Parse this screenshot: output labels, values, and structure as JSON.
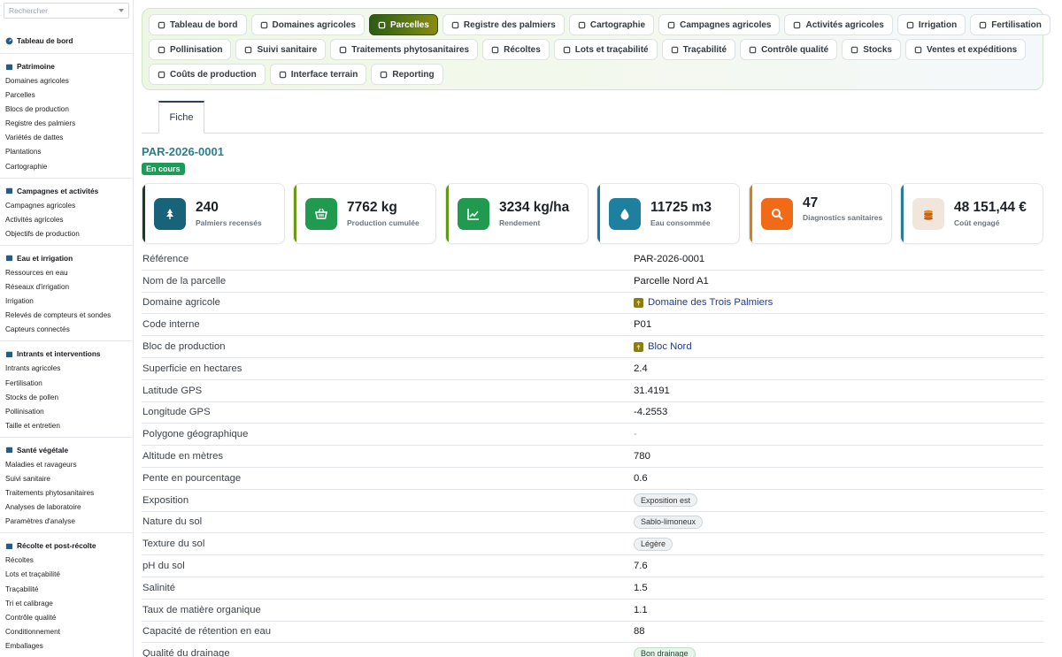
{
  "sidebar": {
    "search_placeholder": "Rechercher",
    "top_link": "Tableau de bord",
    "groups": [
      {
        "title": "Patrimoine",
        "items": [
          "Domaines agricoles",
          "Parcelles",
          "Blocs de production",
          "Registre des palmiers",
          "Variétés de dattes",
          "Plantations",
          "Cartographie"
        ]
      },
      {
        "title": "Campagnes et activités",
        "items": [
          "Campagnes agricoles",
          "Activités agricoles",
          "Objectifs de production"
        ]
      },
      {
        "title": "Eau et irrigation",
        "items": [
          "Ressources en eau",
          "Réseaux d'irrigation",
          "Irrigation",
          "Relevés de compteurs et sondes",
          "Capteurs connectés"
        ]
      },
      {
        "title": "Intrants et interventions",
        "items": [
          "Intrants agricoles",
          "Fertilisation",
          "Stocks de pollen",
          "Pollinisation",
          "Taille et entretien"
        ]
      },
      {
        "title": "Santé végétale",
        "items": [
          "Maladies et ravageurs",
          "Suivi sanitaire",
          "Traitements phytosanitaires",
          "Analyses de laboratoire",
          "Paramètres d'analyse"
        ]
      },
      {
        "title": "Récolte et post-récolte",
        "items": [
          "Récoltes",
          "Lots et traçabilité",
          "Traçabilité",
          "Tri et calibrage",
          "Contrôle qualité",
          "Conditionnement",
          "Emballages"
        ]
      }
    ]
  },
  "modules": {
    "active": "Parcelles",
    "rows": [
      [
        "Tableau de bord",
        "Domaines agricoles",
        "Parcelles",
        "Registre des palmiers",
        "Cartographie",
        "Campagnes agricoles",
        "Activités agricoles",
        "Irrigation",
        "Fertilisation"
      ],
      [
        "Pollinisation",
        "Suivi sanitaire",
        "Traitements phytosanitaires",
        "Récoltes",
        "Lots et traçabilité",
        "Traçabilité",
        "Contrôle qualité",
        "Stocks",
        "Ventes et expéditions"
      ],
      [
        "Coûts de production",
        "Interface terrain",
        "Reporting"
      ]
    ]
  },
  "tabs": {
    "fiche": "Fiche"
  },
  "record": {
    "title": "PAR-2026-0001",
    "status": "En cours"
  },
  "kpis": [
    {
      "value": "240",
      "label": "Palmiers recensés",
      "icon": "palm-tree-icon"
    },
    {
      "value": "7762 kg",
      "label": "Production cumulée",
      "icon": "basket-icon"
    },
    {
      "value": "3234 kg/ha",
      "label": "Rendement",
      "icon": "chart-up-icon"
    },
    {
      "value": "11725 m3",
      "label": "Eau consommée",
      "icon": "water-drop-icon"
    },
    {
      "value": "47",
      "label": "Diagnostics sanitaires",
      "icon": "magnifier-icon"
    },
    {
      "value": "48 151,44 €",
      "label": "Coût engagé",
      "icon": "coins-icon"
    }
  ],
  "colors": {
    "kpi_bars": [
      "#1a3d1e",
      "#6a9a12",
      "#5f9a14",
      "#1b7a92",
      "#e07a16",
      "#2a7d96"
    ],
    "kpi_icon_bg": [
      "#17647a",
      "#1f9a4f",
      "#1f9a4f",
      "#1e7f9e",
      "#f06a18",
      "#f0e6dc"
    ]
  },
  "fields": [
    {
      "label": "Référence",
      "value": "PAR-2026-0001",
      "kind": "text"
    },
    {
      "label": "Nom de la parcelle",
      "value": "Parcelle Nord A1",
      "kind": "text"
    },
    {
      "label": "Domaine agricole",
      "value": "Domaine des Trois Palmiers",
      "kind": "link"
    },
    {
      "label": "Code interne",
      "value": "P01",
      "kind": "text"
    },
    {
      "label": "Bloc de production",
      "value": "Bloc Nord",
      "kind": "link"
    },
    {
      "label": "Superficie en hectares",
      "value": "2.4",
      "kind": "text"
    },
    {
      "label": "Latitude GPS",
      "value": "31.4191",
      "kind": "text"
    },
    {
      "label": "Longitude GPS",
      "value": "-4.2553",
      "kind": "text"
    },
    {
      "label": "Polygone géographique",
      "value": "-",
      "kind": "dim"
    },
    {
      "label": "Altitude en mètres",
      "value": "780",
      "kind": "text"
    },
    {
      "label": "Pente en pourcentage",
      "value": "0.6",
      "kind": "text"
    },
    {
      "label": "Exposition",
      "value": "Exposition est",
      "kind": "chip"
    },
    {
      "label": "Nature du sol",
      "value": "Sablo-limoneux",
      "kind": "chip"
    },
    {
      "label": "Texture du sol",
      "value": "Légère",
      "kind": "chip"
    },
    {
      "label": "pH du sol",
      "value": "7.6",
      "kind": "text"
    },
    {
      "label": "Salinité",
      "value": "1.5",
      "kind": "text"
    },
    {
      "label": "Taux de matière organique",
      "value": "1.1",
      "kind": "text"
    },
    {
      "label": "Capacité de rétention en eau",
      "value": "88",
      "kind": "text"
    },
    {
      "label": "Qualité du drainage",
      "value": "Bon drainage",
      "kind": "chip-green"
    }
  ]
}
